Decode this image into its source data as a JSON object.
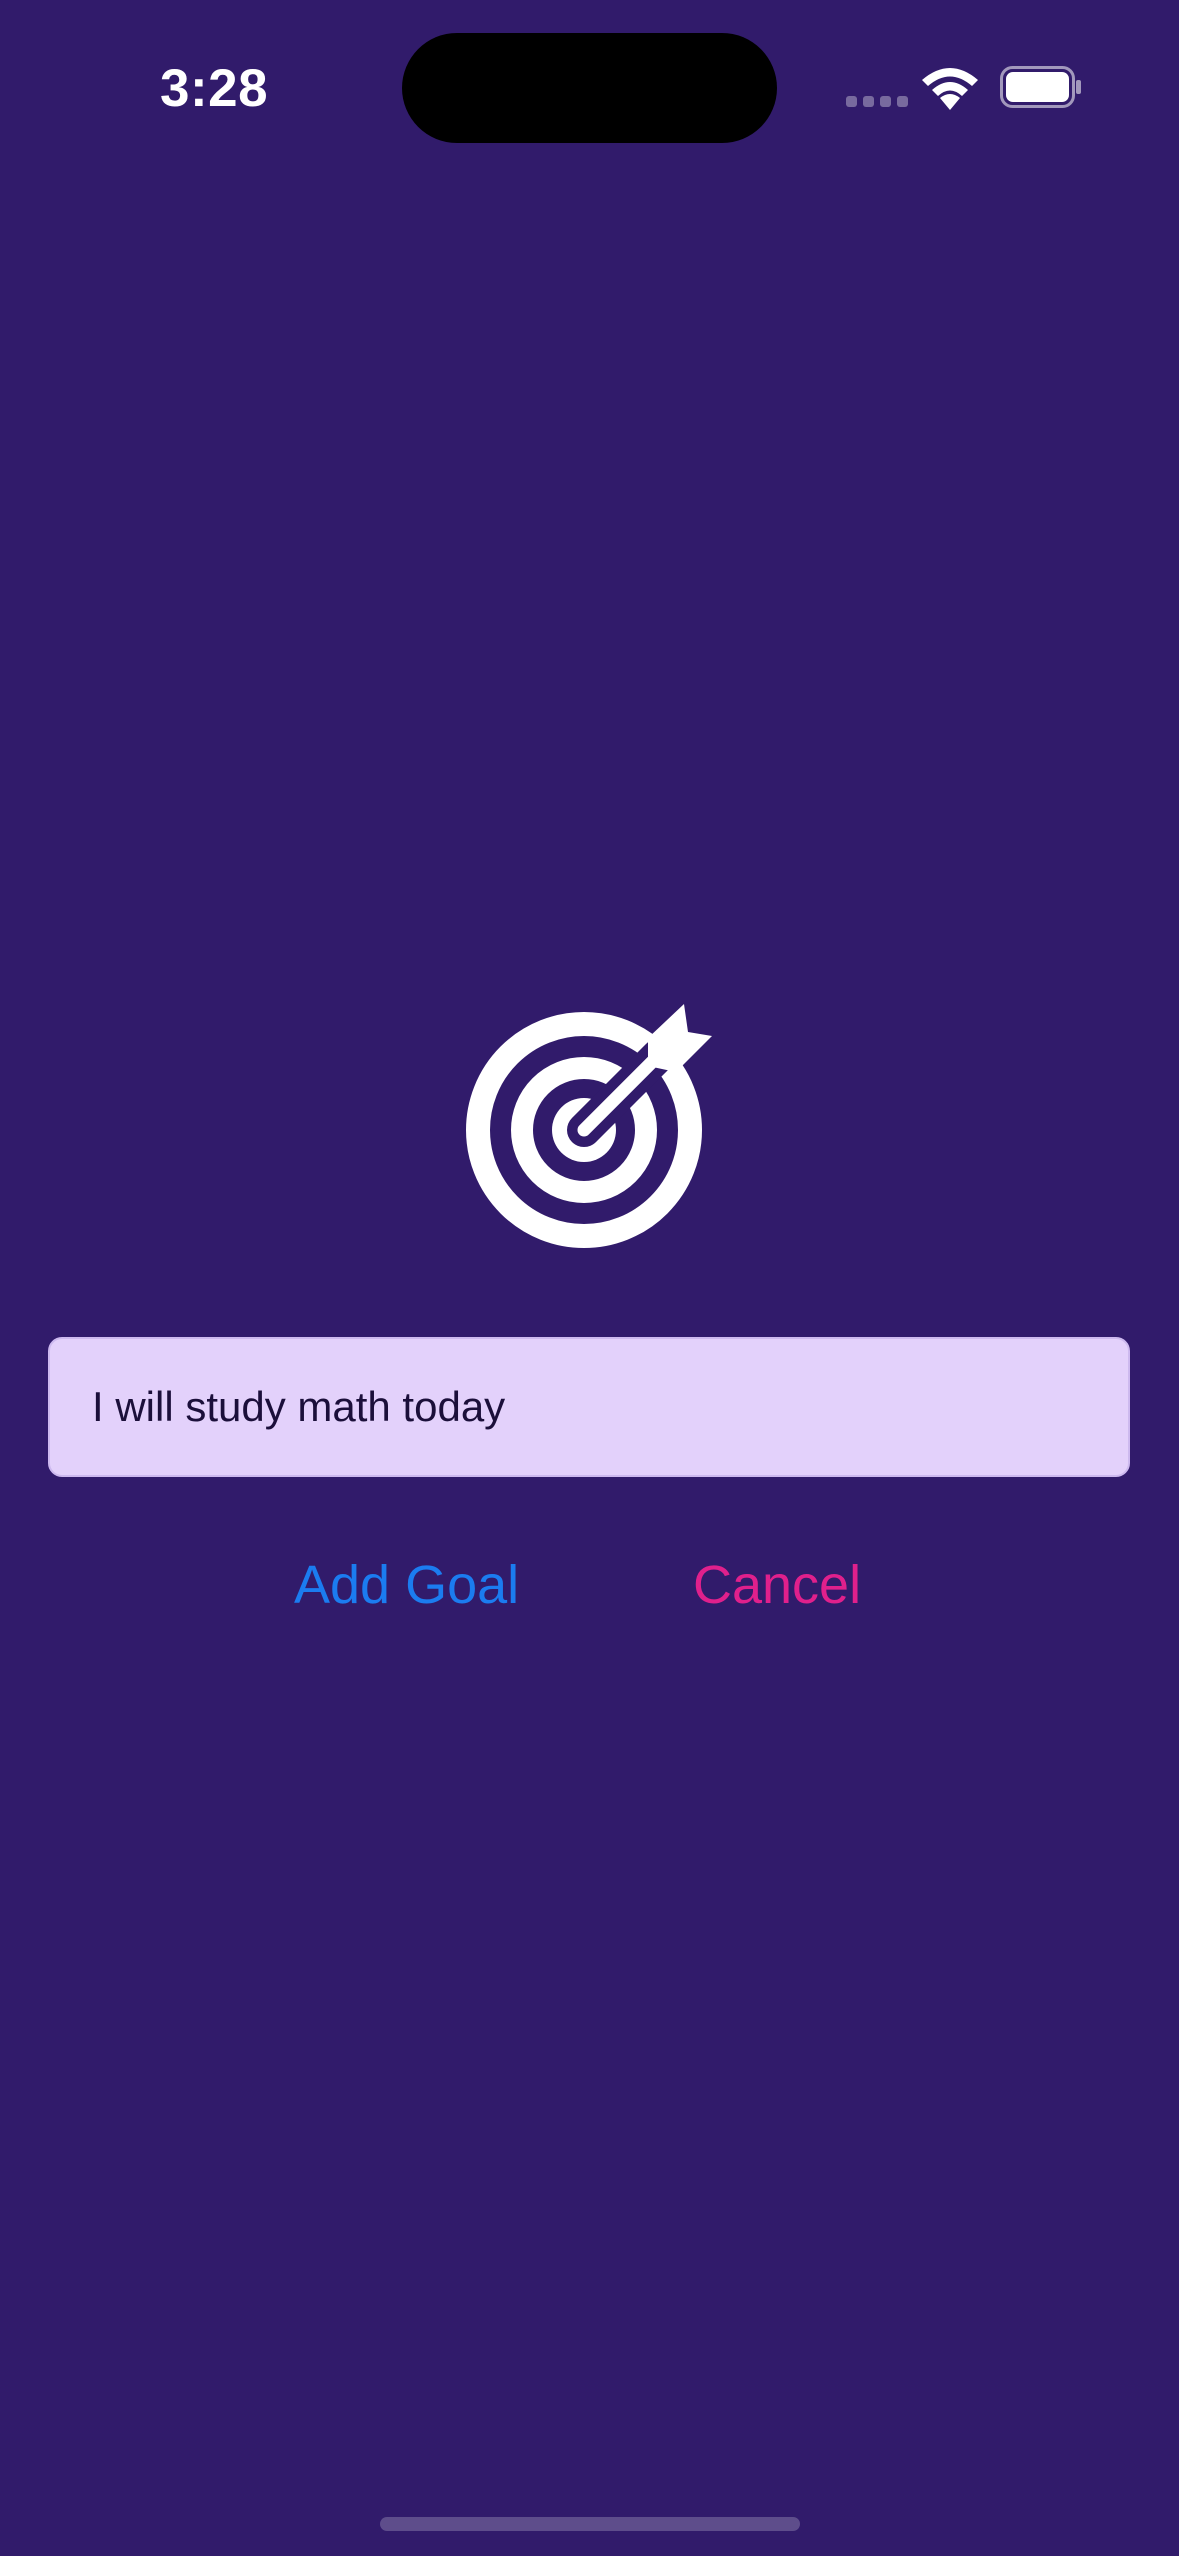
{
  "status_bar": {
    "time": "3:28",
    "icons": [
      "cellular-signal-icon",
      "wifi-icon",
      "battery-icon"
    ]
  },
  "colors": {
    "background": "#311b6b",
    "input_background": "#e3d1fb",
    "add_goal": "#1b7cf0",
    "cancel": "#e0208c"
  },
  "main": {
    "icon": "target-with-arrow-icon",
    "goal_input": {
      "value": "I will study math today"
    },
    "add_goal_label": "Add Goal",
    "cancel_label": "Cancel"
  }
}
